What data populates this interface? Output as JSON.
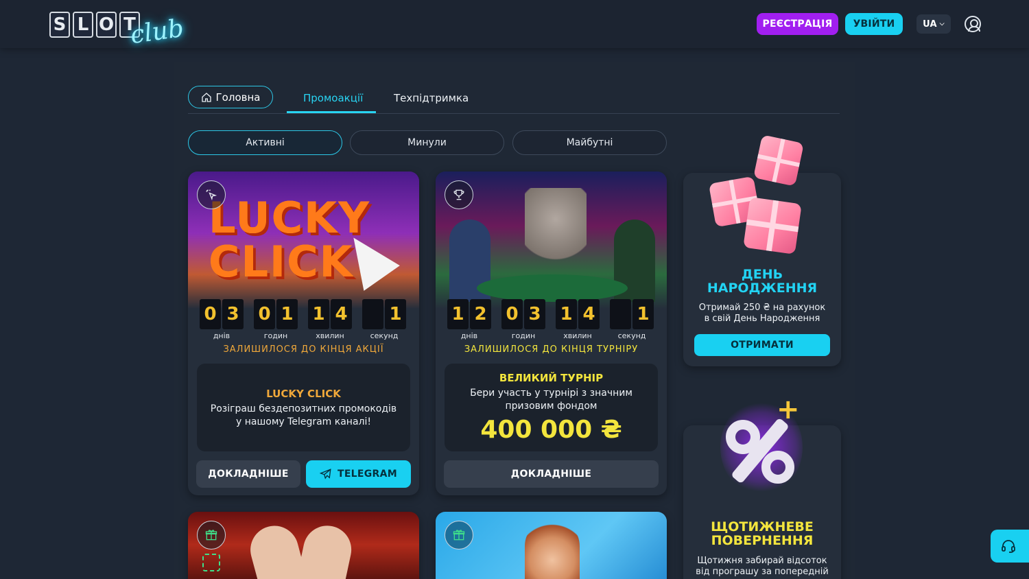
{
  "header": {
    "logo_letters": [
      "S",
      "L",
      "O",
      "T"
    ],
    "logo_script": "club",
    "register_label": "РЕЄСТРАЦІЯ",
    "login_label": "УВІЙТИ",
    "language": "UA"
  },
  "tabs": {
    "home": "Головна",
    "promo": "Промоакції",
    "support": "Техпідтримка"
  },
  "filters": {
    "active": "Активні",
    "past": "Минули",
    "future": "Майбутні"
  },
  "cards": [
    {
      "time": {
        "days": [
          "0",
          "3"
        ],
        "hours": [
          "0",
          "1"
        ],
        "minutes": [
          "1",
          "4"
        ],
        "seconds": [
          "",
          "1"
        ]
      },
      "labels": {
        "days": "днів",
        "hours": "годин",
        "minutes": "хвилин",
        "seconds": "секунд"
      },
      "remaining": "ЗАЛИШИЛОСЯ ДО КІНЦЯ АКЦІЇ",
      "banner_text": "LUCKY CLICK",
      "title": "LUCKY CLICK",
      "desc_line1": "Розіграш бездепозитних промокодів",
      "desc_line2": "у нашому Telegram каналі!",
      "more_label": "ДОКЛАДНІШЕ",
      "telegram_label": "TELEGRAM"
    },
    {
      "time": {
        "days": [
          "1",
          "2"
        ],
        "hours": [
          "0",
          "3"
        ],
        "minutes": [
          "1",
          "4"
        ],
        "seconds": [
          "",
          "1"
        ]
      },
      "labels": {
        "days": "днів",
        "hours": "годин",
        "minutes": "хвилин",
        "seconds": "секунд"
      },
      "remaining": "ЗАЛИШИЛОСЯ ДО КІНЦЯ ТУРНІРУ",
      "title": "ВЕЛИКИЙ ТУРНІР",
      "desc_line1": "Бери участь у турнірі з значним",
      "desc_line2": "призовим фондом",
      "prize": "400 000 ₴",
      "more_label": "ДОКЛАДНІШЕ"
    }
  ],
  "side": {
    "birthday_title_1": "ДЕНЬ",
    "birthday_title_2": "НАРОДЖЕННЯ",
    "birthday_desc_1": "Отримай 250 ₴ на рахунок",
    "birthday_desc_2": "в свій День Народження",
    "birthday_button": "ОТРИМАТИ",
    "weekly_title_1": "ЩОТИЖНЕВЕ",
    "weekly_title_2": "ПОВЕРНЕННЯ",
    "weekly_desc_1": "Щотижня забирай відсоток",
    "weekly_desc_2": "від програшу за попередній"
  },
  "colors": {
    "accent": "#19d0f1",
    "register": "#a11ff0",
    "background": "#1e2735",
    "timer_digit": "#f2c12e",
    "tournament_yellow": "#f3e53d",
    "lucky_orange": "#f0a83a"
  }
}
